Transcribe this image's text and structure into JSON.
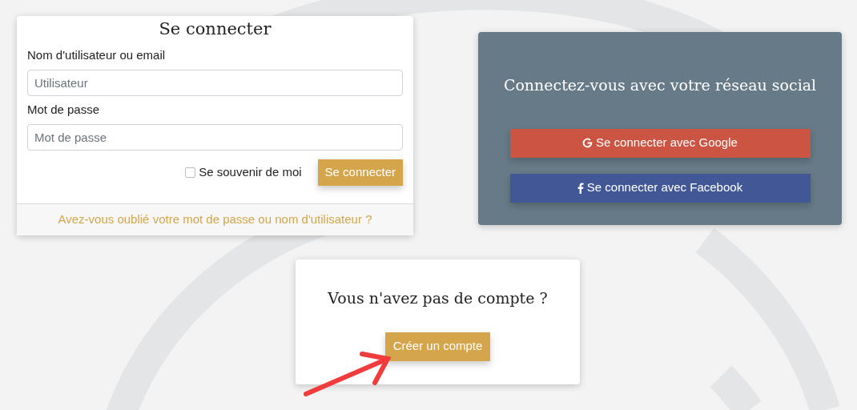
{
  "login": {
    "title": "Se connecter",
    "fields": [
      {
        "label": "Nom d'utilisateur ou email",
        "placeholder": "Utilisateur"
      },
      {
        "label": "Mot de passe",
        "placeholder": "Mot de passe"
      }
    ],
    "remember": {
      "label": "Se souvenir de moi",
      "checked": false
    },
    "submit": "Se connecter",
    "forgot_link": "Avez-vous oublié votre mot de passe ou nom d'utilisateur ?"
  },
  "social": {
    "title": "Connectez-vous avec votre réseau social",
    "buttons": [
      {
        "kind": "google",
        "label": "Se connecter avec Google",
        "color": "#cb5443"
      },
      {
        "kind": "facebook",
        "label": "Se connecter avec Facebook",
        "color": "#425896"
      }
    ]
  },
  "signup": {
    "title": "Vous n'avez pas de compte ?",
    "button": "Créer un compte"
  }
}
